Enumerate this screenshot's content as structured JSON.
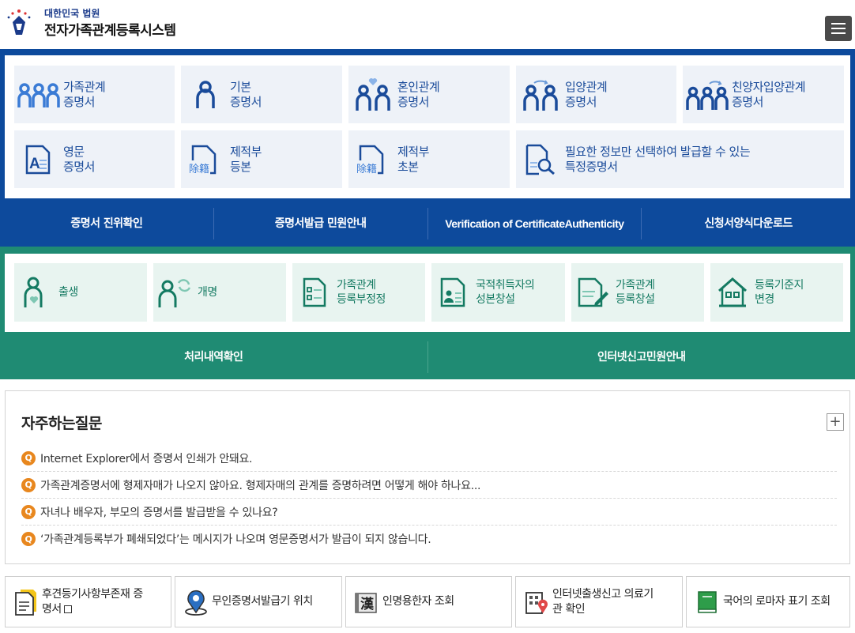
{
  "header": {
    "org": "대한민국 법원",
    "system_name": "전자가족관계등록시스템"
  },
  "certificates": [
    {
      "line1": "가족관계",
      "line2": "증명서",
      "icon": "family-icon"
    },
    {
      "line1": "기본",
      "line2": "증명서",
      "icon": "person-icon"
    },
    {
      "line1": "혼인관계",
      "line2": "증명서",
      "icon": "marriage-icon"
    },
    {
      "line1": "입양관계",
      "line2": "증명서",
      "icon": "adoption-icon"
    },
    {
      "line1": "친양자입양관계",
      "line2": "증명서",
      "icon": "full-adoption-icon"
    },
    {
      "line1": "영문",
      "line2": "증명서",
      "icon": "english-doc-icon"
    },
    {
      "line1": "제적부",
      "line2": "등본",
      "icon": "removed-register-icon"
    },
    {
      "line1": "제적부",
      "line2": "초본",
      "icon": "removed-register-icon"
    },
    {
      "line1": "필요한 정보만 선택하여 발급할 수 있는",
      "line2": "특정증명서",
      "icon": "doc-search-icon"
    }
  ],
  "register_icon_text": "除籍",
  "english_icon_text": "A",
  "blue_links": [
    "증명서 진위확인",
    "증명서발급 민원안내",
    "Verification of CertificateAuthenticity",
    "신청서양식다운로드"
  ],
  "reports": [
    {
      "line1": "출생",
      "line2": "",
      "icon": "birth-icon"
    },
    {
      "line1": "개명",
      "line2": "",
      "icon": "rename-icon"
    },
    {
      "line1": "가족관계",
      "line2": "등록부정정",
      "icon": "checklist-icon"
    },
    {
      "line1": "국적취득자의",
      "line2": "성본창설",
      "icon": "nationality-icon"
    },
    {
      "line1": "가족관계",
      "line2": "등록창설",
      "icon": "create-register-icon"
    },
    {
      "line1": "등록기준지",
      "line2": "변경",
      "icon": "house-icon"
    }
  ],
  "green_links": [
    "처리내역확인",
    "인터넷신고민원안내"
  ],
  "faq": {
    "title": "자주하는질문",
    "more": "+",
    "badge": "Q",
    "items": [
      "Internet Explorer에서 증명서 인쇄가 안돼요.",
      "가족관계증명서에 형제자매가 나오지 않아요. 형제자매의 관계를 증명하려면 어떻게 해야 하나요...",
      "자녀나 배우자, 부모의 증명서를 발급받을 수 있나요?",
      "‘가족관계등록부가 폐쇄되었다’는 메시지가 나오며 영문증명서가 발급이 되지 않습니다."
    ]
  },
  "quick_links": [
    {
      "line1": "후견등기사항부존재 증",
      "line2": "명서",
      "icon": "document-icon"
    },
    {
      "line1": "무인증명서발급기 위치",
      "line2": "",
      "icon": "location-pin-icon"
    },
    {
      "line1": "인명용한자 조회",
      "line2": "",
      "icon": "hanja-book-icon"
    },
    {
      "line1": "인터넷출생신고 의료기",
      "line2": "관 확인",
      "icon": "hospital-icon"
    },
    {
      "line1": "국어의 로마자 표기 조회",
      "line2": "",
      "icon": "green-book-icon"
    }
  ],
  "hanja_icon_text": "漢",
  "colors": {
    "blue": "#0d4a9c",
    "green": "#1f8b73",
    "faq_badge": "#e8871e"
  }
}
